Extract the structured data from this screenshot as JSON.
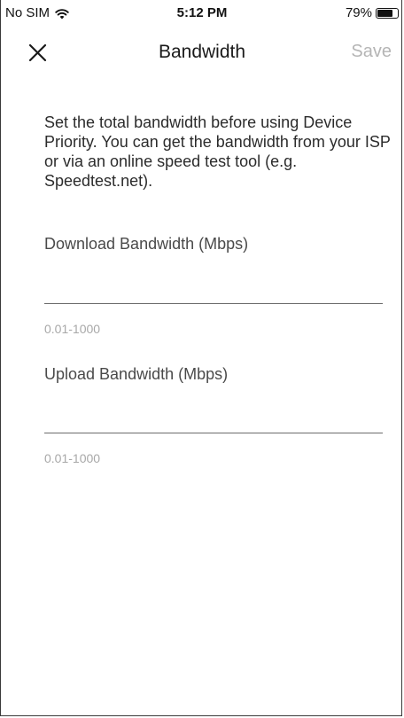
{
  "status_bar": {
    "carrier": "No SIM",
    "time": "5:12 PM",
    "battery_percent_label": "79%",
    "battery_level": 0.79,
    "wifi_icon": "wifi-icon",
    "battery_icon": "battery-icon"
  },
  "nav": {
    "close_icon": "close-icon",
    "title": "Bandwidth",
    "save_label": "Save",
    "save_color": "#b5b5b5"
  },
  "description": "Set the total bandwidth before using Device Priority. You can get the bandwidth from your ISP or via an online speed test tool (e.g. Speedtest.net).",
  "download": {
    "label": "Download Bandwidth (Mbps)",
    "value": "",
    "hint": "0.01-1000"
  },
  "upload": {
    "label": "Upload Bandwidth (Mbps)",
    "value": "",
    "hint": "0.01-1000"
  }
}
